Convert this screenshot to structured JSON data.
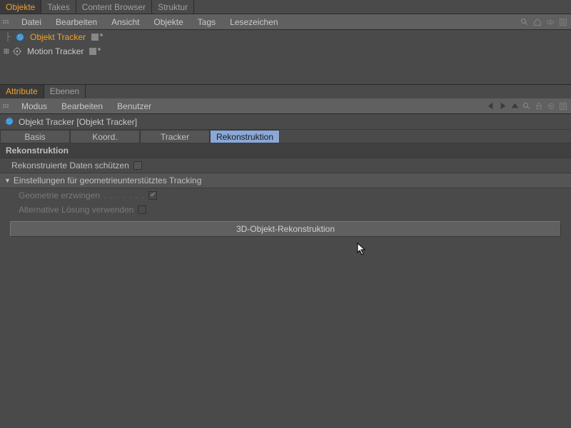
{
  "top_tabs": {
    "items": [
      "Objekte",
      "Takes",
      "Content Browser",
      "Struktur"
    ],
    "active_index": 0
  },
  "object_menu": {
    "items": [
      "Datei",
      "Bearbeiten",
      "Ansicht",
      "Objekte",
      "Tags",
      "Lesezeichen"
    ]
  },
  "object_tree": {
    "items": [
      {
        "name": "Objekt Tracker",
        "selected": true,
        "expandable": false,
        "icon": "sphere"
      },
      {
        "name": "Motion Tracker",
        "selected": false,
        "expandable": true,
        "icon": "motion"
      }
    ]
  },
  "attribute_tabs": {
    "items": [
      "Attribute",
      "Ebenen"
    ],
    "active_index": 0
  },
  "attribute_menu": {
    "items": [
      "Modus",
      "Bearbeiten",
      "Benutzer"
    ]
  },
  "object_header": {
    "title": "Objekt Tracker [Objekt Tracker]"
  },
  "property_tabs": {
    "items": [
      "Basis",
      "Koord.",
      "Tracker",
      "Rekonstruktion"
    ],
    "active_index": 3
  },
  "section": {
    "title": "Rekonstruktion",
    "protect_data_label": "Rekonstruierte Daten schützen",
    "protect_data_checked": false,
    "sub_section_title": "Einstellungen für geometrieunterstütztes Tracking",
    "force_geometry_label": "Geometrie erzwingen",
    "force_geometry_checked": true,
    "alt_solution_label": "Alternative Lösung verwenden",
    "alt_solution_checked": false,
    "button_label": "3D-Objekt-Rekonstruktion"
  }
}
